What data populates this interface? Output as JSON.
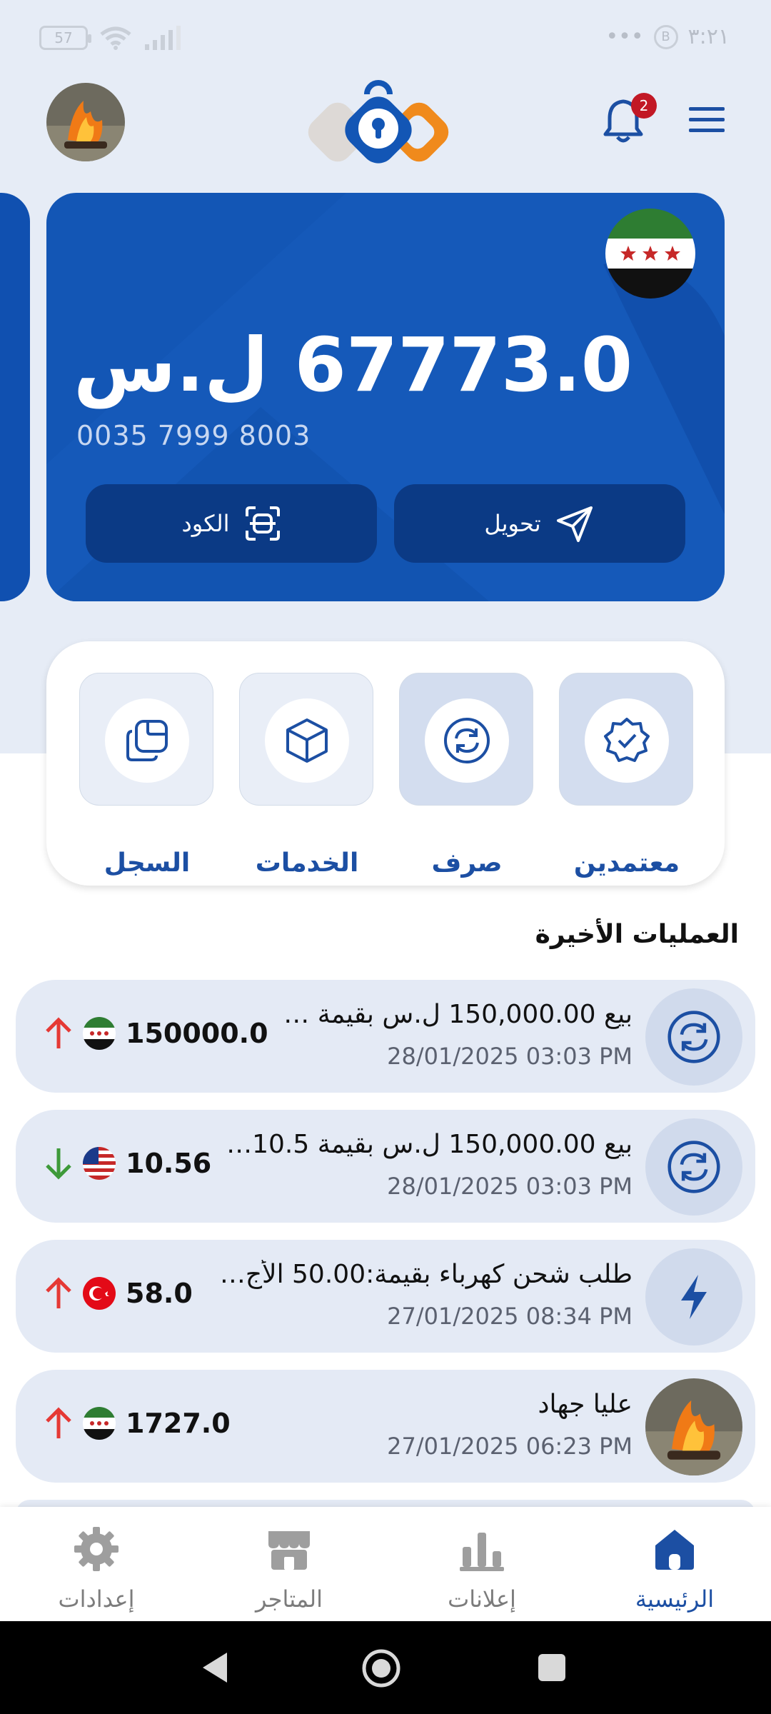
{
  "status_bar": {
    "battery": "57",
    "time": "٣:٢١",
    "dots": "•••",
    "b_icon": "B"
  },
  "header": {
    "notification_count": "2"
  },
  "card": {
    "balance": "67773.0 ل.س",
    "account_number": "0035 7999 8003",
    "transfer_label": "تحويل",
    "code_label": "الكود"
  },
  "quick_actions": [
    {
      "label": "معتمدين",
      "icon": "verified-badge-icon"
    },
    {
      "label": "صرف",
      "icon": "exchange-icon"
    },
    {
      "label": "الخدمات",
      "icon": "box-icon"
    },
    {
      "label": "السجل",
      "icon": "history-icon"
    }
  ],
  "recent": {
    "title": "العمليات الأخيرة",
    "items": [
      {
        "title": "بيع 150,000.00 ل.س بقيمة …",
        "date": "28/01/2025  03:03 PM",
        "amount": "150000.0",
        "flag": "syria-flag-icon",
        "direction": "up",
        "icon": "exchange-icon"
      },
      {
        "title": "بيع 150,000.00 ل.س بقيمة 10.5…",
        "date": "28/01/2025  03:03 PM",
        "amount": "10.56",
        "flag": "usa-flag-icon",
        "direction": "down",
        "icon": "exchange-icon"
      },
      {
        "title": "طلب شحن كهرباء بقيمة:50.00 الأج…",
        "date": "27/01/2025  08:34 PM",
        "amount": "58.0",
        "flag": "turkey-flag-icon",
        "direction": "up",
        "icon": "lightning-icon"
      },
      {
        "title": "عليا جهاد",
        "date": "27/01/2025  06:23 PM",
        "amount": "1727.0",
        "flag": "syria-flag-icon",
        "direction": "up",
        "icon": "avatar"
      }
    ]
  },
  "bottom_nav": [
    {
      "label": "الرئيسية",
      "icon": "home-icon",
      "active": true
    },
    {
      "label": "إعلانات",
      "icon": "chart-icon",
      "active": false
    },
    {
      "label": "المتاجر",
      "icon": "store-icon",
      "active": false
    },
    {
      "label": "إعدادات",
      "icon": "gear-icon",
      "active": false
    }
  ],
  "colors": {
    "primary": "#1356b5",
    "dark_button": "#0b3a85",
    "accent_orange": "#f08a1c",
    "up_arrow": "#e53935",
    "down_arrow": "#3e9a3a"
  }
}
